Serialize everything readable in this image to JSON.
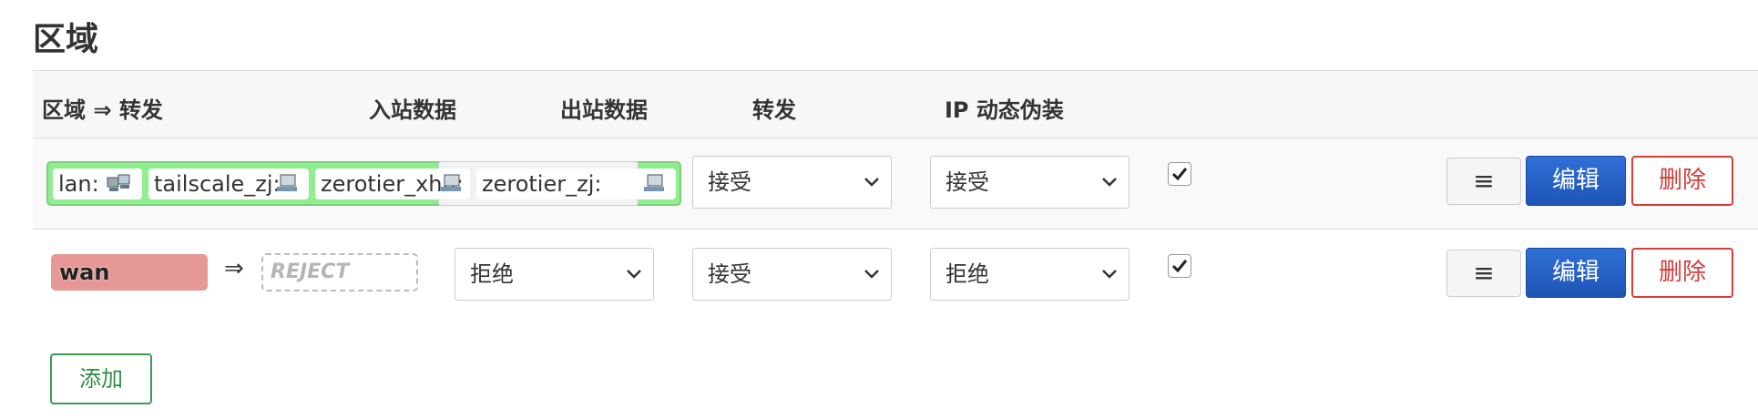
{
  "section_title": "区域",
  "table": {
    "headers": {
      "zone_forward": "区域 ⇒ 转发",
      "input": "入站数据",
      "output": "出站数据",
      "forward": "转发",
      "masq": "IP 动态伪装"
    },
    "rows": [
      {
        "zone_chips": [
          "lan:",
          "tailscale_zj:",
          "zerotier_xhh:",
          "zerotier_zj:"
        ],
        "input": "接受",
        "output": "接受",
        "forward": "接受",
        "masquerade_checked": true,
        "actions": {
          "menu": "≡",
          "edit": "编辑",
          "delete": "删除"
        }
      },
      {
        "zone": "wan",
        "arrow": "⇒",
        "forward_target": "REJECT",
        "input": "拒绝",
        "output": "接受",
        "forward": "拒绝",
        "masquerade_checked": true,
        "actions": {
          "menu": "≡",
          "edit": "编辑",
          "delete": "删除"
        }
      }
    ]
  },
  "add_button": "添加",
  "colors": {
    "lan_group": "#90ee90",
    "wan_badge": "#e59896",
    "edit_button": "#2563c9",
    "delete_border": "#d43f3a",
    "add_border": "#3b9a55"
  },
  "icons": [
    "network-device-icon",
    "check-icon",
    "chevron-down-icon",
    "menu-icon"
  ]
}
